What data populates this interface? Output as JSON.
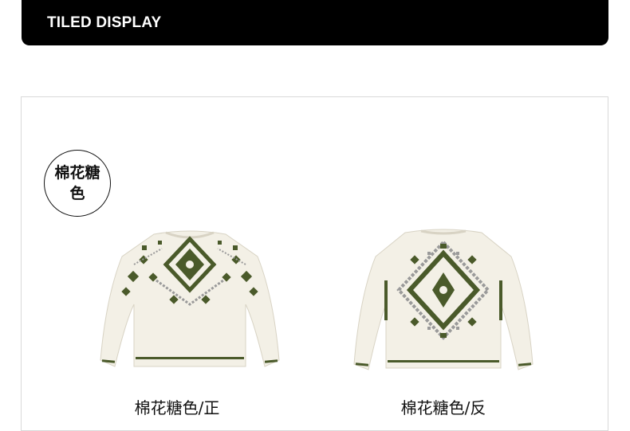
{
  "header": {
    "title": "TILED DISPLAY"
  },
  "color_badge": {
    "label": "棉花糖色"
  },
  "products": [
    {
      "caption": "棉花糖色/正",
      "view": "front"
    },
    {
      "caption": "棉花糖色/反",
      "view": "back"
    }
  ],
  "colors": {
    "header_bg": "#000000",
    "header_text": "#ffffff",
    "sweater_base": "#f3f0e6",
    "pattern_green": "#4a5a2a",
    "pattern_grey": "#9a9a9a"
  }
}
